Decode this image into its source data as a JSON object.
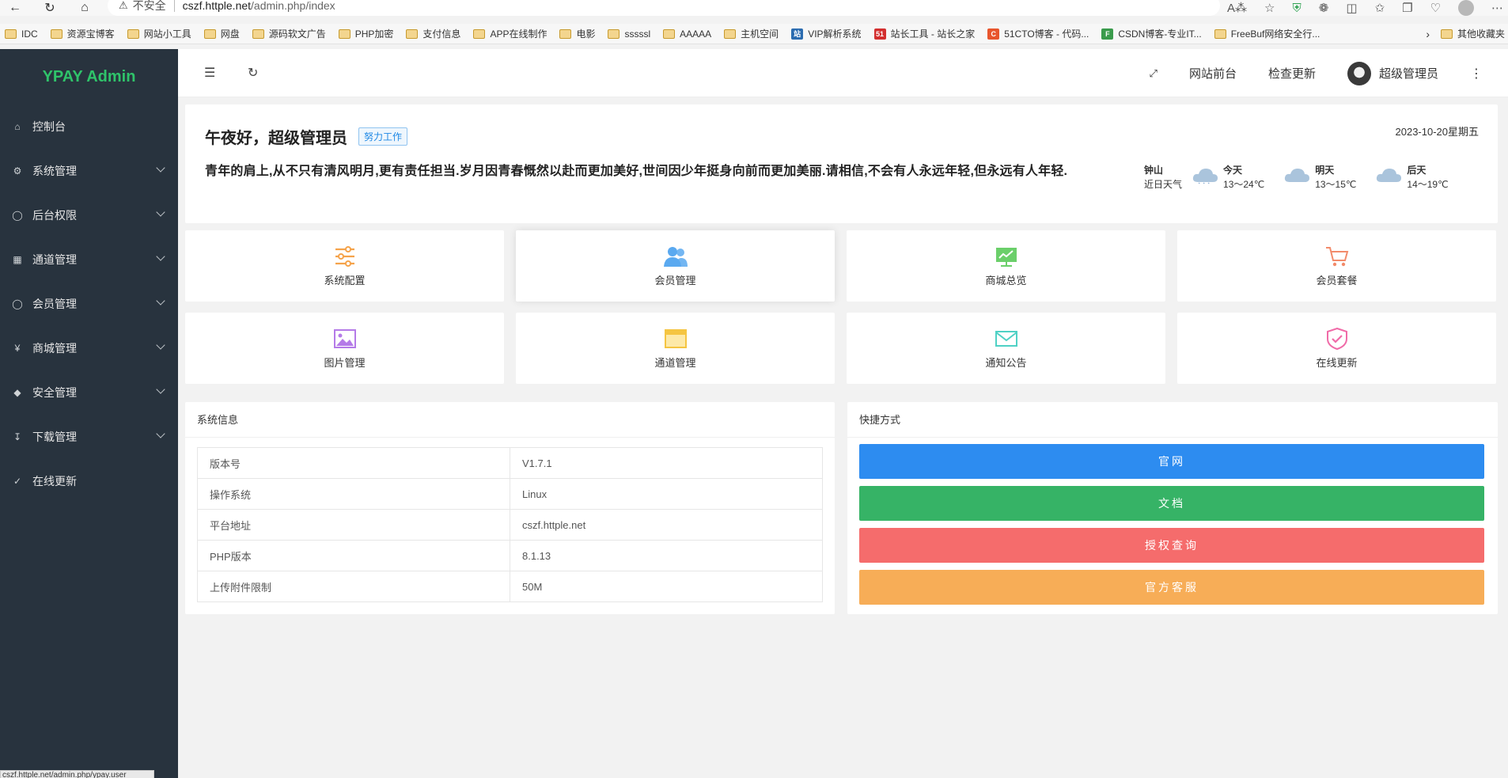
{
  "browser": {
    "insecure_label": "不安全",
    "url_host": "cszf.httple.net",
    "url_path": "/admin.php/index",
    "bookmarks": [
      "IDC",
      "资源宝博客",
      "网站小工具",
      "网盘",
      "源码软文广告",
      "PHP加密",
      "支付信息",
      "APP在线制作",
      "电影",
      "sssssl",
      "AAAAA",
      "主机空间",
      "VIP解析系统",
      "站长工具 - 站长之家",
      "51CTO博客 - 代码...",
      "CSDN博客-专业IT...",
      "FreeBuf网络安全行..."
    ],
    "other_bookmarks": "其他收藏夹",
    "status_url": "cszf.httple.net/admin.php/ypay.user"
  },
  "sidebar": {
    "logo": "YPAY Admin",
    "items": [
      {
        "label": "控制台",
        "icon": "home-icon"
      },
      {
        "label": "系统管理",
        "icon": "gear-icon"
      },
      {
        "label": "后台权限",
        "icon": "user-icon"
      },
      {
        "label": "通道管理",
        "icon": "apps-icon"
      },
      {
        "label": "会员管理",
        "icon": "user-icon"
      },
      {
        "label": "商城管理",
        "icon": "yen-icon"
      },
      {
        "label": "安全管理",
        "icon": "diamond-icon"
      },
      {
        "label": "下载管理",
        "icon": "download-icon"
      },
      {
        "label": "在线更新",
        "icon": "shield-check-icon"
      }
    ]
  },
  "header": {
    "front_link": "网站前台",
    "update_link": "检查更新",
    "user_name": "超级管理员"
  },
  "welcome": {
    "greeting": "午夜好，超级管理员",
    "badge": "努力工作",
    "motto": "青年的肩上,从不只有清风明月,更有责任担当.岁月因青春慨然以赴而更加美好,世间因少年挺身向前而更加美丽.请相信,不会有人永远年轻,但永远有人年轻.",
    "date": "2023-10-20星期五",
    "weather": {
      "city": "钟山",
      "subtitle": "近日天气",
      "days": [
        {
          "day": "今天",
          "temp": "13～24℃"
        },
        {
          "day": "明天",
          "temp": "13～15℃"
        },
        {
          "day": "后天",
          "temp": "14～19℃"
        }
      ]
    }
  },
  "tiles": [
    {
      "label": "系统配置",
      "color": "#f5a34b"
    },
    {
      "label": "会员管理",
      "color": "#5aa9f0"
    },
    {
      "label": "商城总览",
      "color": "#6bcf6a"
    },
    {
      "label": "会员套餐",
      "color": "#f28b6b"
    },
    {
      "label": "图片管理",
      "color": "#b57be8"
    },
    {
      "label": "通道管理",
      "color": "#f5c542"
    },
    {
      "label": "通知公告",
      "color": "#4fd1c5"
    },
    {
      "label": "在线更新",
      "color": "#f06ba8"
    }
  ],
  "system_info": {
    "title": "系统信息",
    "rows": [
      {
        "key": "版本号",
        "value": "V1.7.1"
      },
      {
        "key": "操作系统",
        "value": "Linux"
      },
      {
        "key": "平台地址",
        "value": "cszf.httple.net"
      },
      {
        "key": "PHP版本",
        "value": "8.1.13"
      },
      {
        "key": "上传附件限制",
        "value": "50M"
      }
    ]
  },
  "shortcuts": {
    "title": "快捷方式",
    "buttons": [
      {
        "label": "官网",
        "color": "#2d8cf0"
      },
      {
        "label": "文档",
        "color": "#36b366"
      },
      {
        "label": "授权查询",
        "color": "#f56c6c"
      },
      {
        "label": "官方客服",
        "color": "#f7ad57"
      }
    ]
  }
}
